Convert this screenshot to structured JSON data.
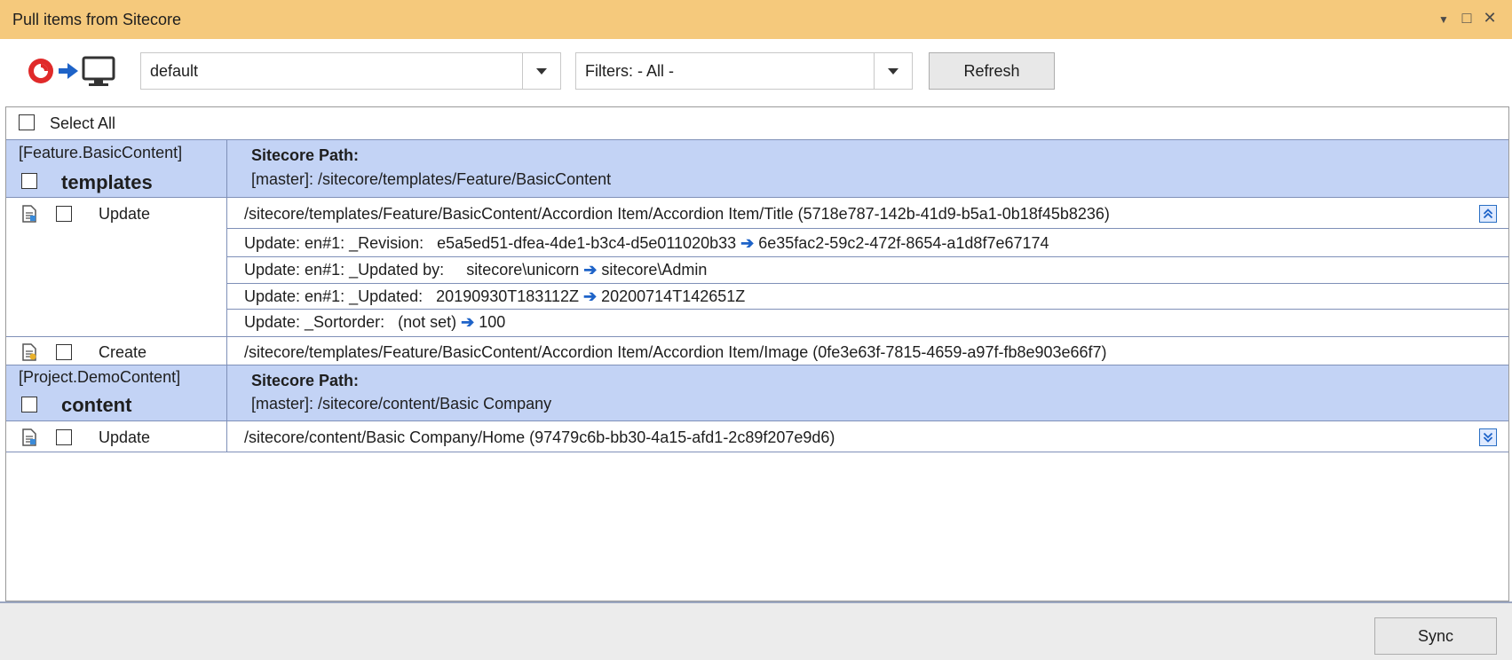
{
  "window": {
    "title": "Pull items from Sitecore",
    "controls": {
      "dropdown": "▼",
      "maximize": "□",
      "close": "✕"
    }
  },
  "toolbar": {
    "connection_value": "default",
    "filter_value": "Filters:  - All -",
    "refresh_label": "Refresh"
  },
  "select_all_label": "Select All",
  "groups": [
    {
      "module": "[Feature.BasicContent]",
      "name": "templates",
      "path_label": "Sitecore Path:",
      "path": "[master]: /sitecore/templates/Feature/BasicContent",
      "items": [
        {
          "action": "Update",
          "path": "/sitecore/templates/Feature/BasicContent/Accordion Item/Accordion Item/Title  (5718e787-142b-41d9-b5a1-0b18f45b8236)",
          "changes": [
            {
              "label": "Update: en#1: _Revision:",
              "from": "e5a5ed51-dfea-4de1-b3c4-d5e011020b33",
              "to": "6e35fac2-59c2-472f-8654-a1d8f7e67174"
            },
            {
              "label": "Update: en#1: _Updated by:",
              "from": "sitecore\\unicorn",
              "to": "sitecore\\Admin"
            },
            {
              "label": "Update: en#1: _Updated:",
              "from": "20190930T183112Z",
              "to": "20200714T142651Z"
            },
            {
              "label": "Update: _Sortorder:",
              "from": "(not set)",
              "to": "100"
            }
          ]
        },
        {
          "action": "Create",
          "path": "/sitecore/templates/Feature/BasicContent/Accordion Item/Accordion Item/Image  (0fe3e63f-7815-4659-a97f-fb8e903e66f7)"
        }
      ]
    },
    {
      "module": "[Project.DemoContent]",
      "name": "content",
      "path_label": "Sitecore Path:",
      "path": "[master]: /sitecore/content/Basic Company",
      "items": [
        {
          "action": "Update",
          "path": "/sitecore/content/Basic Company/Home  (97479c6b-bb30-4a15-afd1-2c89f207e9d6)"
        }
      ]
    }
  ],
  "sync_label": "Sync",
  "arrow_glyph": "➔",
  "colors": {
    "titlebar": "#f5c97c",
    "group_header": "#c3d3f5",
    "arrow": "#1e63c8"
  },
  "icons": [
    "sitecore-logo-icon",
    "arrow-right-icon",
    "monitor-icon",
    "document-icon",
    "collapse-icon",
    "expand-icon"
  ]
}
